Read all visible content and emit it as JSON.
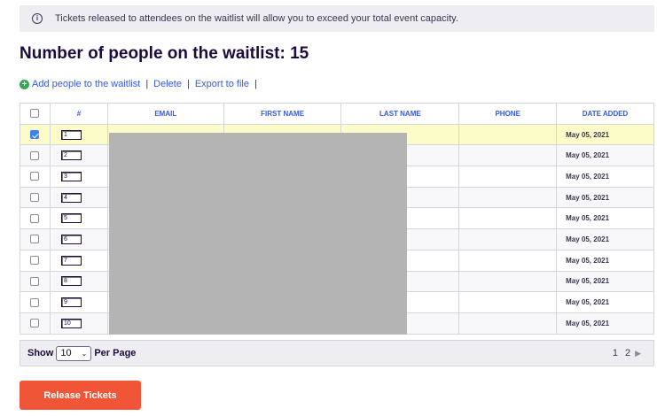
{
  "notice": {
    "icon": "info-icon",
    "text": "Tickets released to attendees on the waitlist will allow you to exceed your total event capacity."
  },
  "title": "Number of people on the waitlist: 15",
  "actions": {
    "add_icon": "plus-circle-icon",
    "add_label": "Add people to the waitlist",
    "delete_label": "Delete",
    "export_label": "Export to file",
    "separator": "|"
  },
  "table": {
    "headers": {
      "num": "#",
      "email": "EMAIL",
      "first_name": "FIRST NAME",
      "last_name": "LAST NAME",
      "phone": "PHONE",
      "date_added": "DATE ADDED"
    },
    "rows": [
      {
        "checked": true,
        "num": "1",
        "date": "May 05, 2021"
      },
      {
        "checked": false,
        "num": "2",
        "date": "May 05, 2021"
      },
      {
        "checked": false,
        "num": "3",
        "date": "May 05, 2021"
      },
      {
        "checked": false,
        "num": "4",
        "date": "May 05, 2021"
      },
      {
        "checked": false,
        "num": "5",
        "date": "May 05, 2021"
      },
      {
        "checked": false,
        "num": "6",
        "date": "May 05, 2021"
      },
      {
        "checked": false,
        "num": "7",
        "date": "May 05, 2021"
      },
      {
        "checked": false,
        "num": "8",
        "date": "May 05, 2021"
      },
      {
        "checked": false,
        "num": "9",
        "date": "May 05, 2021"
      },
      {
        "checked": false,
        "num": "10",
        "date": "May 05, 2021"
      }
    ]
  },
  "pager": {
    "show_label": "Show",
    "per_page_value": "10",
    "per_page_label": "Per Page",
    "pages": [
      "1",
      "2"
    ],
    "next_icon": "next-arrow-icon"
  },
  "release_button": "Release Tickets",
  "colors": {
    "accent": "#3659e3",
    "release": "#f05537",
    "selected_row": "#fcfcc8",
    "redaction": "#b4b4b4"
  }
}
